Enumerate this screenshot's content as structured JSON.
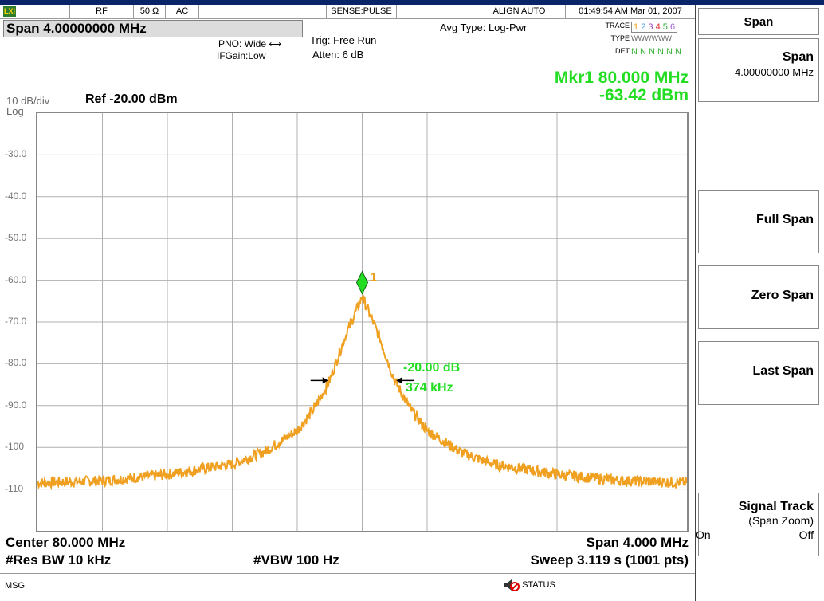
{
  "status_bar": {
    "app_mode": "LXI",
    "rf": "RF",
    "impedance": "50 Ω",
    "coupling": "AC",
    "sense": "SENSE:PULSE",
    "align": "ALIGN AUTO",
    "datetime": "01:49:54 AM Mar 01, 2007"
  },
  "span_display": "Span 4.00000000 MHz",
  "settings": {
    "pno": "PNO: Wide",
    "ifgain": "IFGain:Low",
    "trig": "Trig: Free Run",
    "atten": "Atten: 6 dB",
    "avg_type": "Avg Type: Log-Pwr"
  },
  "trace_table": {
    "trace_label": "TRACE",
    "type_label": "TYPE",
    "det_label": "DET",
    "trace_numbers": [
      "1",
      "2",
      "3",
      "4",
      "5",
      "6"
    ],
    "trace_colors": [
      "#f0a020",
      "#3fa0e0",
      "#a040c0",
      "#e03030",
      "#30b030",
      "#a060d0"
    ],
    "types": "WWWWWW",
    "dets": "N N N N N N"
  },
  "marker": {
    "line1": "Mkr1 80.000 MHz",
    "line2": "-63.42 dBm",
    "label": "1",
    "delta_line1": "-20.00 dB",
    "delta_line2": "374 kHz"
  },
  "scale": {
    "per_div": "10 dB/div",
    "log_label": "Log",
    "ref": "Ref -20.00 dBm"
  },
  "y_ticks": [
    "-30.0",
    "-40.0",
    "-50.0",
    "-60.0",
    "-70.0",
    "-80.0",
    "-90.0",
    "-100",
    "-110"
  ],
  "footer": {
    "center": "Center 80.000 MHz",
    "span": "Span 4.000 MHz",
    "res_bw": "#Res BW 10 kHz",
    "vbw": "#VBW 100 Hz",
    "sweep": "Sweep  3.119 s (1001 pts)"
  },
  "msg_bar": {
    "msg": "MSG",
    "status": "STATUS"
  },
  "softkeys": {
    "title": "Span",
    "span_label": "Span",
    "span_value": "4.00000000 MHz",
    "full_span": "Full Span",
    "zero_span": "Zero Span",
    "last_span": "Last Span",
    "signal_track": "Signal Track",
    "signal_track_sub": "(Span Zoom)",
    "signal_track_on": "On",
    "signal_track_off": "Off"
  },
  "chart_data": {
    "type": "line",
    "x_center_mhz": 80.0,
    "x_span_mhz": 4.0,
    "x": [
      78.0,
      78.4,
      78.8,
      79.2,
      79.4,
      79.6,
      79.7,
      79.8,
      79.9,
      80.0,
      80.1,
      80.2,
      80.3,
      80.4,
      80.6,
      80.8,
      81.2,
      81.6,
      82.0
    ],
    "y": [
      -108.5,
      -108,
      -106.5,
      -104,
      -101,
      -96,
      -91,
      -84,
      -73,
      -64,
      -73,
      -84,
      -91,
      -96,
      -101,
      -104,
      -106.5,
      -108,
      -108.5
    ],
    "ylim": [
      -120,
      -20
    ],
    "grid": true,
    "trace_color": "#f0a020"
  }
}
